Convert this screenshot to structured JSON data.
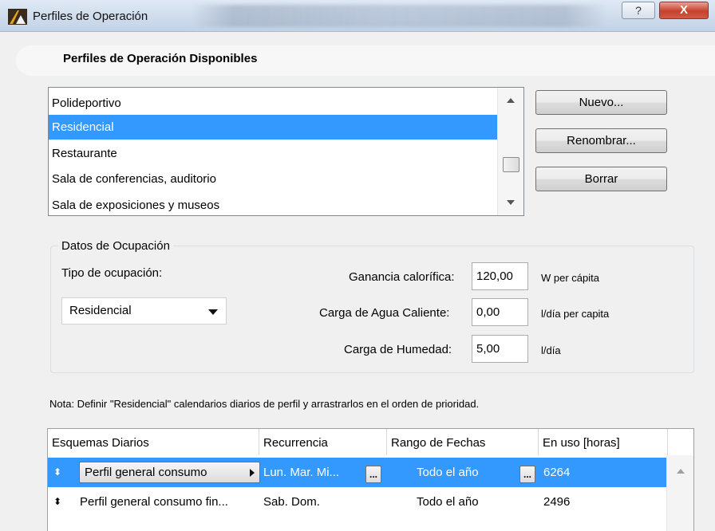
{
  "window": {
    "title": "Perfiles de Operación",
    "help_label": "?",
    "close_label": "X"
  },
  "profiles": {
    "section_title": "Perfiles de Operación Disponibles",
    "items": [
      "Polideportivo",
      "Residencial",
      "Restaurante",
      "Sala de conferencias, auditorio",
      "Sala de exposiciones y museos"
    ],
    "selected_index": 1,
    "buttons": {
      "new_label": "Nuevo...",
      "rename_label": "Renombrar...",
      "delete_label": "Borrar"
    }
  },
  "occupancy": {
    "group_title": "Datos de Ocupación",
    "type_label": "Tipo de ocupación:",
    "type_value": "Residencial",
    "heat_gain_label": "Ganancia calorífica:",
    "heat_gain_value": "120,00",
    "heat_gain_unit": "W per cápita",
    "hot_water_label": "Carga de Agua Caliente:",
    "hot_water_value": "0,00",
    "hot_water_unit": "l/día per capita",
    "humidity_label": "Carga de Humedad:",
    "humidity_value": "5,00",
    "humidity_unit": "l/día"
  },
  "note": "Nota: Definir \"Residencial\" calendarios diarios de perfil y arrastrarlos en el orden de prioridad.",
  "schedules": {
    "columns": [
      "Esquemas Diarios",
      "Recurrencia",
      "Rango de Fechas",
      "En uso [horas]"
    ],
    "rows": [
      {
        "name": "Perfil general consumo",
        "recurrence": "Lun. Mar. Mi...",
        "date_range": "Todo el año",
        "hours": "6264"
      },
      {
        "name": "Perfil general consumo fin...",
        "recurrence": "Sab. Dom.",
        "date_range": "Todo el año",
        "hours": "2496"
      }
    ],
    "dots_label": "...",
    "drag_glyph": "⬍"
  },
  "colors": {
    "selection": "#3399ff",
    "close_button": "#c7402c"
  }
}
